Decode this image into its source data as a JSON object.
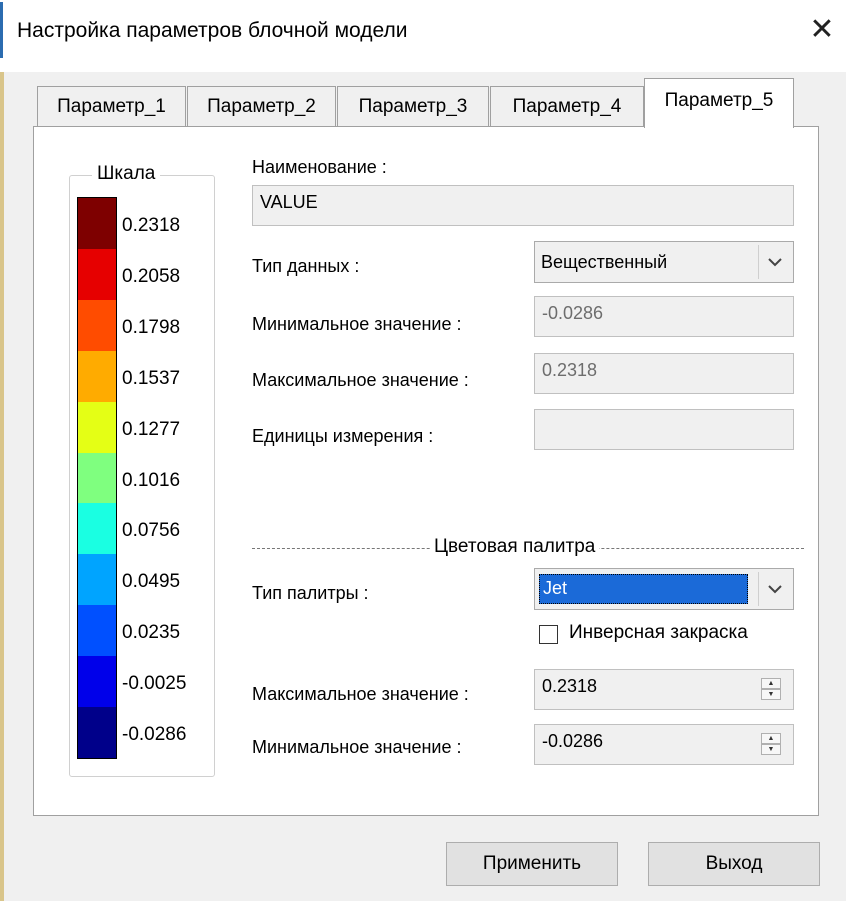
{
  "window": {
    "title": "Настройка параметров блочной модели",
    "close_glyph": "✕"
  },
  "tabs": [
    {
      "label": "Параметр_1",
      "active": false
    },
    {
      "label": "Параметр_2",
      "active": false
    },
    {
      "label": "Параметр_3",
      "active": false
    },
    {
      "label": "Параметр_4",
      "active": false
    },
    {
      "label": "Параметр_5",
      "active": true
    }
  ],
  "scale": {
    "title": "Шкала",
    "labels": [
      "0.2318",
      "0.2058",
      "0.1798",
      "0.1537",
      "0.1277",
      "0.1016",
      "0.0756",
      "0.0495",
      "0.0235",
      "-0.0025",
      "-0.0286"
    ],
    "colors": [
      "#7e0000",
      "#e60000",
      "#ff4c00",
      "#ffab00",
      "#e4ff15",
      "#7fff7f",
      "#1affe2",
      "#00a4ff",
      "#0050ff",
      "#0000ea",
      "#00008a"
    ]
  },
  "form": {
    "name_label": "Наименование :",
    "name_value": "VALUE",
    "data_type_label": "Тип данных :",
    "data_type_value": "Вещественный",
    "min_label": "Минимальное значение :",
    "min_value": "-0.0286",
    "max_label": "Максимальное значение :",
    "max_value": "0.2318",
    "units_label": "Единицы измерения :",
    "units_value": ""
  },
  "palette": {
    "section_title": "Цветовая палитра",
    "type_label": "Тип палитры :",
    "type_value": "Jet",
    "inverse_label": "Инверсная закраска",
    "inverse_checked": false,
    "max_label": "Максимальное значение :",
    "max_value": "0.2318",
    "min_label": "Минимальное значение :",
    "min_value": "-0.0286"
  },
  "buttons": {
    "apply": "Применить",
    "exit": "Выход"
  },
  "icons": {
    "dropdown": "chevron-down-icon",
    "spinner": "spin-arrows-icon",
    "close": "close-icon"
  }
}
